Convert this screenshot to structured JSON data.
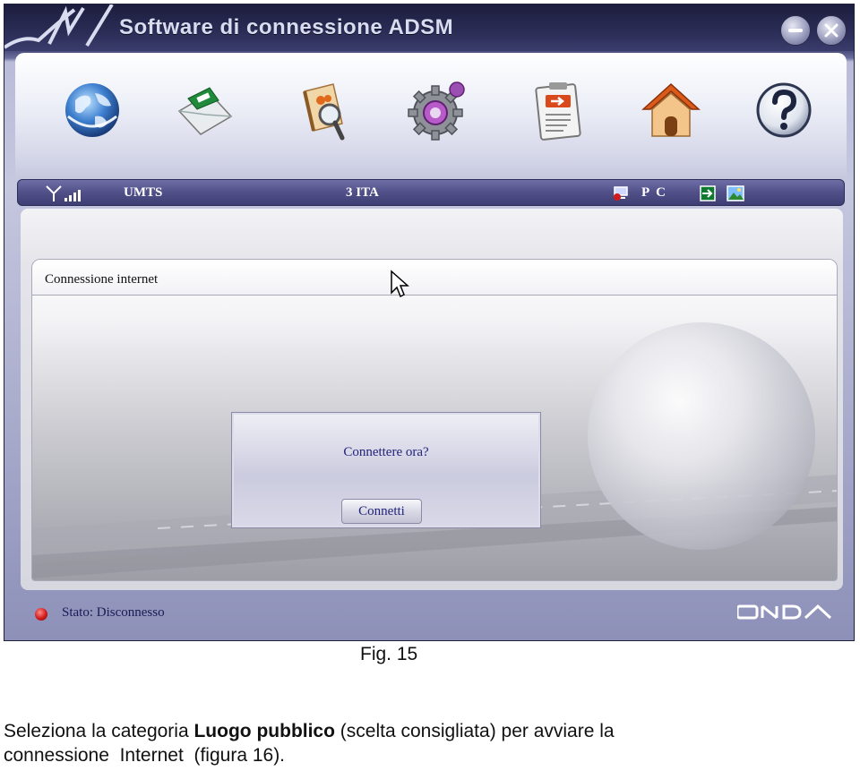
{
  "window": {
    "title": "Software di connessione ADSM",
    "controls": [
      "minimize-icon",
      "close-icon"
    ]
  },
  "toolbar": {
    "buttons": [
      {
        "name": "globe-icon",
        "interactable": true
      },
      {
        "name": "sms-envelope-icon",
        "interactable": true
      },
      {
        "name": "phonebook-icon",
        "interactable": true
      },
      {
        "name": "settings-gear-icon",
        "interactable": true
      },
      {
        "name": "clipboard-transfer-icon",
        "interactable": true
      },
      {
        "name": "home-icon",
        "interactable": true
      },
      {
        "name": "help-icon",
        "interactable": true
      }
    ]
  },
  "status_strip": {
    "network_type": "UMTS",
    "operator": "3 ITA",
    "mode": "P C"
  },
  "content": {
    "section_title": "Connessione internet",
    "dialog": {
      "question": "Connettere ora?",
      "button_label": "Connetti"
    }
  },
  "footer": {
    "status": "Stato: Disconnesso",
    "brand": "ONDA",
    "status_color": "#d11b1b"
  },
  "caption": "Fig. 15",
  "body": {
    "line1_prefix": "Seleziona la categoria ",
    "line1_bold": "Luogo pubblico",
    "line1_suffix": " (scelta consigliata) per avviare la",
    "line2": "connessione  Internet  (figura 16)."
  }
}
